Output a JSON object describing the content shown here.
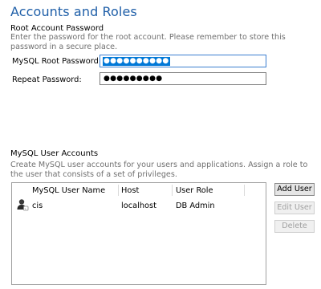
{
  "page": {
    "title": "Accounts and Roles"
  },
  "root": {
    "title": "Root Account Password",
    "description": "Enter the password for the root account.  Please remember to store this password in a secure place.",
    "root_label": "MySQL Root Password:",
    "root_value": "●●●●●●●●●●",
    "repeat_label": "Repeat Password:",
    "repeat_value": "●●●●●●●●●"
  },
  "users": {
    "title": "MySQL User Accounts",
    "description": "Create MySQL user accounts for your users and applications. Assign a role to the user that consists of a set of privileges.",
    "columns": [
      "MySQL User Name",
      "Host",
      "User Role"
    ],
    "rows": [
      {
        "name": "cis",
        "host": "localhost",
        "role": "DB Admin",
        "icon": "user-avatar-icon"
      }
    ],
    "buttons": {
      "add": "Add User",
      "edit": "Edit User",
      "delete": "Delete"
    }
  },
  "colors": {
    "title": "#1f5fa8",
    "selection": "#0078d7"
  }
}
